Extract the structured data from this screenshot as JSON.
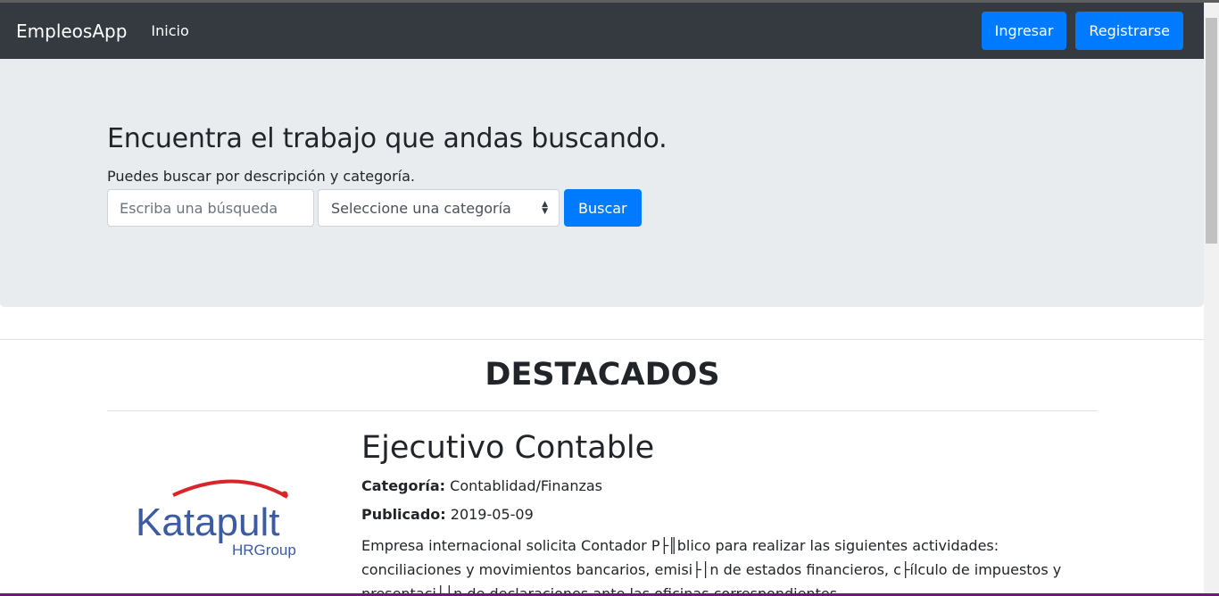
{
  "navbar": {
    "brand": "EmpleosApp",
    "home": "Inicio",
    "login": "Ingresar",
    "register": "Registrarse"
  },
  "hero": {
    "title": "Encuentra el trabajo que andas buscando.",
    "subtitle": "Puedes buscar por descripción y categoría.",
    "search_placeholder": "Escriba una búsqueda",
    "category_selected": "Seleccione una categoría",
    "search_button": "Buscar"
  },
  "featured": {
    "heading": "DESTACADOS",
    "job": {
      "logo_text": "Katapult",
      "logo_subtext": "HRGroup",
      "title": "Ejecutivo Contable",
      "category_label": "Categoría:",
      "category": "Contablidad/Finanzas",
      "published_label": "Publicado:",
      "published": "2019-05-09",
      "description": "Empresa internacional solicita Contador P├║blico para realizar las siguientes actividades: conciliaciones y movimientos bancarios, emisi├│n de estados financieros, c├ílculo de impuestos y presentaci├│n de declaraciones ante las oficinas correspondientes."
    }
  },
  "colors": {
    "navbar_bg": "#343a40",
    "primary": "#007bff",
    "jumbotron_bg": "#e9ecef",
    "logo_blue": "#3b5ba5",
    "logo_red": "#d6262b"
  }
}
